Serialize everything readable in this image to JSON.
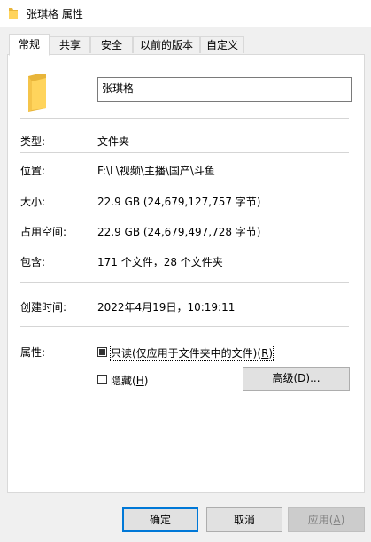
{
  "window": {
    "title": "张琪格 属性"
  },
  "tabs": [
    {
      "label": "常规",
      "active": true
    },
    {
      "label": "共享",
      "active": false
    },
    {
      "label": "安全",
      "active": false
    },
    {
      "label": "以前的版本",
      "active": false
    },
    {
      "label": "自定义",
      "active": false
    }
  ],
  "general": {
    "name_value": "张琪格",
    "type_label": "类型:",
    "type_value": "文件夹",
    "location_label": "位置:",
    "location_value": "F:\\L\\视频\\主播\\国产\\斗鱼",
    "size_label": "大小:",
    "size_value": "22.9 GB (24,679,127,757 字节)",
    "disk_size_label": "占用空间:",
    "disk_size_value": "22.9 GB (24,679,497,728 字节)",
    "contains_label": "包含:",
    "contains_value": "171 个文件，28 个文件夹",
    "created_label": "创建时间:",
    "created_value": "2022年4月19日，10:19:11",
    "attributes_label": "属性:",
    "readonly_label": "只读(仅应用于文件夹中的文件)",
    "readonly_accel": "R",
    "readonly_state": "indeterminate",
    "hidden_label": "隐藏",
    "hidden_accel": "H",
    "hidden_state": "unchecked",
    "advanced_label": "高级",
    "advanced_accel": "D",
    "advanced_suffix": "..."
  },
  "footer": {
    "ok_label": "确定",
    "cancel_label": "取消",
    "apply_label": "应用",
    "apply_accel": "A"
  },
  "colors": {
    "folder_body": "#ffd45c",
    "folder_back": "#e8b53a",
    "default_button_border": "#0078d7"
  },
  "icons": {
    "title": "folder-icon",
    "large": "folder-icon"
  }
}
